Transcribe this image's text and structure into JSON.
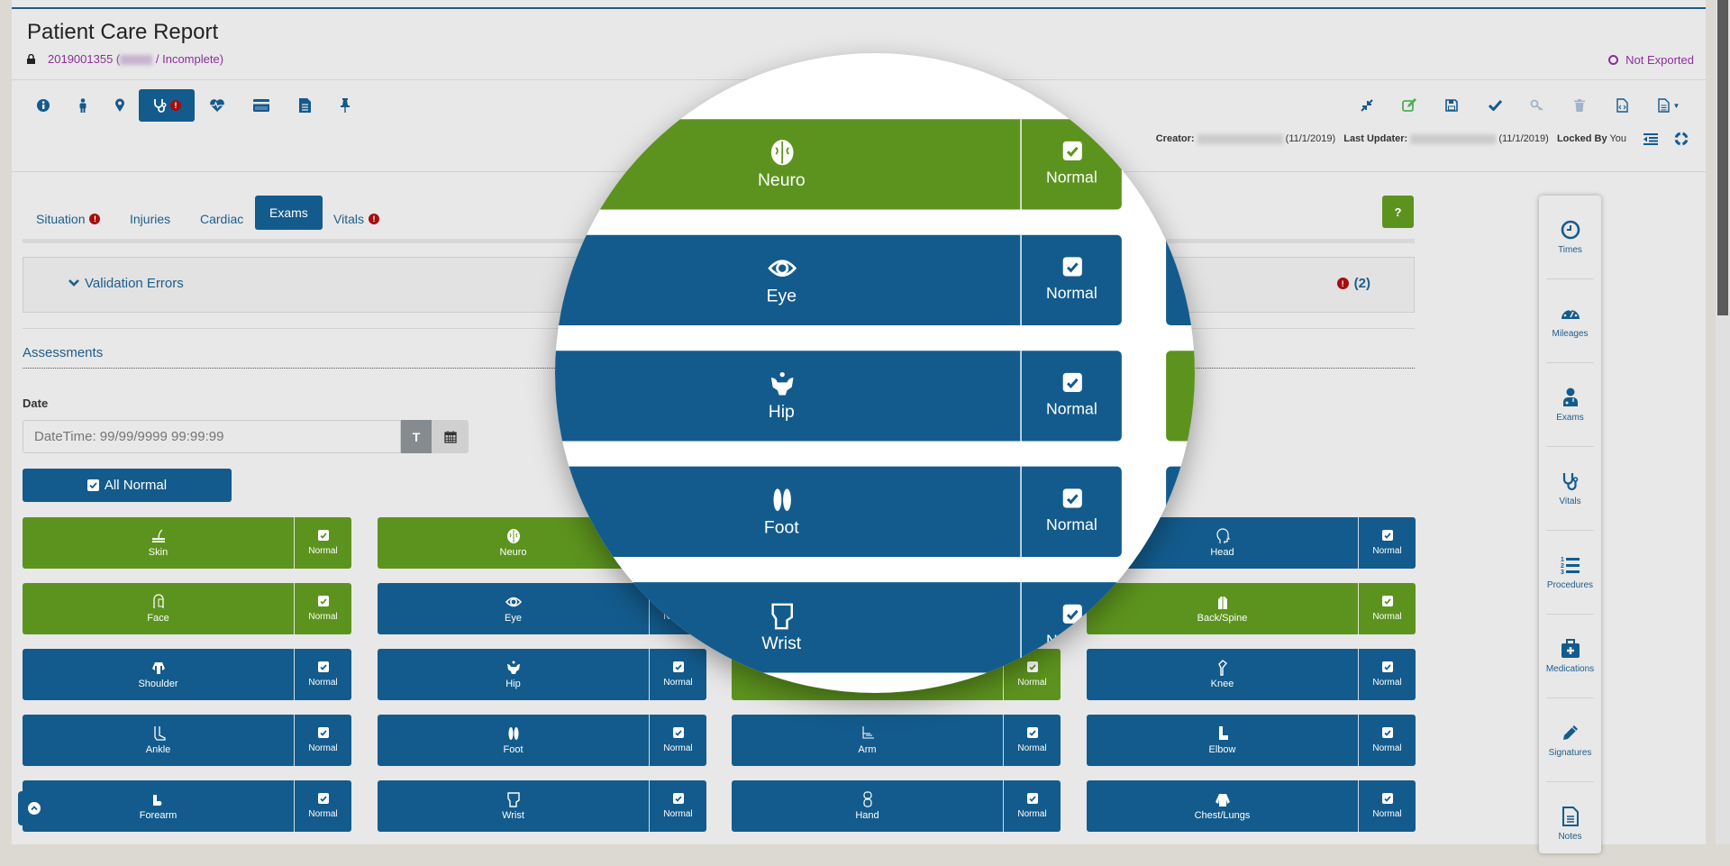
{
  "header": {
    "title": "Patient Care Report",
    "record_id": "2019001355",
    "status": "/ Incomplete)",
    "export_status": "Not Exported"
  },
  "toolbar_left": [
    "info-icon",
    "person-icon",
    "map-marker-icon",
    "stethoscope-icon",
    "heartbeat-icon",
    "credit-card-icon",
    "document-icon",
    "pin-icon"
  ],
  "toolbar_right": [
    "compress-icon",
    "edit-icon",
    "save-icon",
    "check-icon",
    "key-icon",
    "trash-icon",
    "code-file-icon",
    "document-dropdown-icon"
  ],
  "meta": {
    "creator_label": "Creator:",
    "creator_date": "(11/1/2019)",
    "updater_label": "Last Updater:",
    "updater_date": "(11/1/2019)",
    "locked_label": "Locked By",
    "locked_value": "You"
  },
  "tabs": [
    {
      "label": "Situation",
      "error": true
    },
    {
      "label": "Injuries"
    },
    {
      "label": "Cardiac"
    },
    {
      "label": "Exams",
      "active": true
    },
    {
      "label": "Vitals",
      "error": true
    }
  ],
  "help_label": "?",
  "validation": {
    "label": "Validation Errors",
    "count": "(2)"
  },
  "assessments": {
    "heading": "Assessments",
    "date_label": "Date",
    "date_placeholder": "DateTime: 99/99/9999 99:99:99",
    "now_button": "T",
    "all_normal": "All Normal"
  },
  "exams": [
    [
      {
        "label": "Skin",
        "color": "green",
        "icon": "skin"
      },
      {
        "label": "Neuro",
        "color": "green",
        "icon": "brain"
      },
      {
        "label": "",
        "color": "blue",
        "icon": ""
      },
      {
        "label": "Head",
        "color": "blue",
        "icon": "head"
      }
    ],
    [
      {
        "label": "Face",
        "color": "green",
        "icon": "face"
      },
      {
        "label": "Eye",
        "color": "blue",
        "icon": "eye"
      },
      {
        "label": "",
        "color": "blue",
        "icon": ""
      },
      {
        "label": "Back/Spine",
        "color": "green",
        "icon": "spine"
      }
    ],
    [
      {
        "label": "Shoulder",
        "color": "blue",
        "icon": "shoulder"
      },
      {
        "label": "Hip",
        "color": "blue",
        "icon": "hip"
      },
      {
        "label": "",
        "color": "green",
        "icon": ""
      },
      {
        "label": "Knee",
        "color": "blue",
        "icon": "knee"
      }
    ],
    [
      {
        "label": "Ankle",
        "color": "blue",
        "icon": "ankle"
      },
      {
        "label": "Foot",
        "color": "blue",
        "icon": "foot"
      },
      {
        "label": "Arm",
        "color": "blue",
        "icon": "arm"
      },
      {
        "label": "Elbow",
        "color": "blue",
        "icon": "elbow"
      }
    ],
    [
      {
        "label": "Forearm",
        "color": "blue",
        "icon": "forearm"
      },
      {
        "label": "Wrist",
        "color": "blue",
        "icon": "wrist"
      },
      {
        "label": "Hand",
        "color": "blue",
        "icon": "hand"
      },
      {
        "label": "Chest/Lungs",
        "color": "blue",
        "icon": "chest"
      }
    ]
  ],
  "normal_label": "Normal",
  "right_nav": [
    {
      "label": "Times",
      "icon": "clock-icon"
    },
    {
      "label": "Mileages",
      "icon": "dashboard-icon"
    },
    {
      "label": "Exams",
      "icon": "doctor-icon"
    },
    {
      "label": "Vitals",
      "icon": "stethoscope-icon"
    },
    {
      "label": "Procedures",
      "icon": "numbered-list-icon"
    },
    {
      "label": "Medications",
      "icon": "medkit-icon"
    },
    {
      "label": "Signatures",
      "icon": "pencil-icon"
    },
    {
      "label": "Notes",
      "icon": "document-icon"
    }
  ],
  "colors": {
    "primary": "#135b8c",
    "green": "#5c931e",
    "error": "#a50e0e",
    "purple": "#8b2f9a"
  }
}
